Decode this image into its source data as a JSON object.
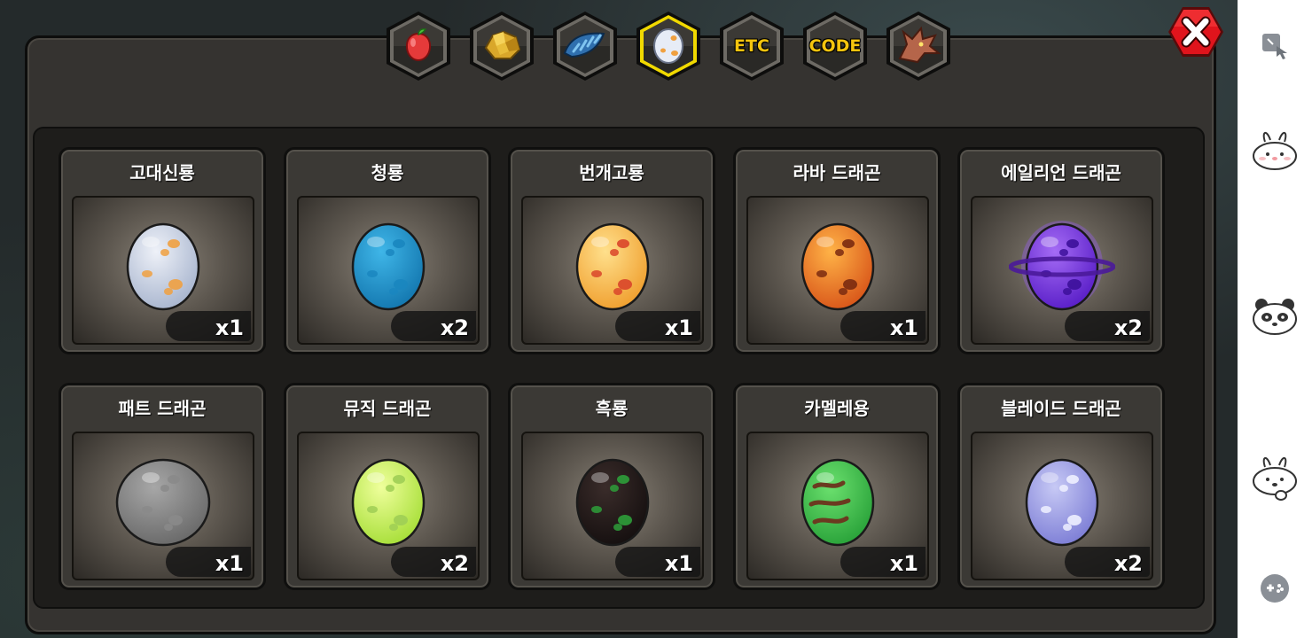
{
  "tabs": [
    {
      "id": "fruit",
      "icon": "fruit-icon",
      "selected": false
    },
    {
      "id": "ore",
      "icon": "gold-ore-icon",
      "selected": false
    },
    {
      "id": "scale",
      "icon": "dragon-scale-icon",
      "selected": false
    },
    {
      "id": "egg",
      "icon": "egg-icon",
      "selected": true
    },
    {
      "id": "etc",
      "label": "ETC",
      "selected": false
    },
    {
      "id": "code",
      "label": "CODE",
      "selected": false
    },
    {
      "id": "dragon",
      "icon": "dragon-head-icon",
      "selected": false
    }
  ],
  "eggs": [
    {
      "name": "고대신룡",
      "count": "x1",
      "colors": [
        "#eef1f8",
        "#a9b6cf"
      ],
      "spots": "#f0a040"
    },
    {
      "name": "청룡",
      "count": "x2",
      "colors": [
        "#3fb6e8",
        "#1478b0"
      ],
      "spots": "#1a86bf"
    },
    {
      "name": "번개고룡",
      "count": "x1",
      "colors": [
        "#ffe08c",
        "#f0a030"
      ],
      "spots": "#d9452a"
    },
    {
      "name": "라바 드래곤",
      "count": "x1",
      "colors": [
        "#ffb347",
        "#d9571a"
      ],
      "spots": "#7a2a10"
    },
    {
      "name": "에일리언 드래곤",
      "count": "x2",
      "colors": [
        "#a56cf5",
        "#5a1fc8"
      ],
      "spots": "#3c0f9a"
    },
    {
      "name": "패트 드래곤",
      "count": "x1",
      "colors": [
        "#a7a7a7",
        "#6a6a6a"
      ],
      "spots": "#8a8a8a"
    },
    {
      "name": "뮤직 드래곤",
      "count": "x2",
      "colors": [
        "#efff9c",
        "#a8df3a"
      ],
      "spots": "#9fce55"
    },
    {
      "name": "흑룡",
      "count": "x1",
      "colors": [
        "#3a2c2a",
        "#161010"
      ],
      "spots": "#2e9e3a"
    },
    {
      "name": "카멜레용",
      "count": "x1",
      "colors": [
        "#6be06e",
        "#2aa33a"
      ],
      "spots": "#6b3a20"
    },
    {
      "name": "블레이드 드래곤",
      "count": "x2",
      "colors": [
        "#c7c9f5",
        "#7e7fd6"
      ],
      "spots": "#eef0ff"
    }
  ],
  "sidebar": [
    {
      "icon": "screen-touch-icon"
    },
    {
      "icon": "bunny-emoticon-icon"
    },
    {
      "icon": "panda-emoticon-icon"
    },
    {
      "icon": "bunny-wave-icon"
    },
    {
      "icon": "gamepad-icon"
    }
  ],
  "colors": {
    "tab_text": "#f4c40e",
    "tab_selected_border": "#f1d900",
    "close_red": "#e0141c"
  }
}
